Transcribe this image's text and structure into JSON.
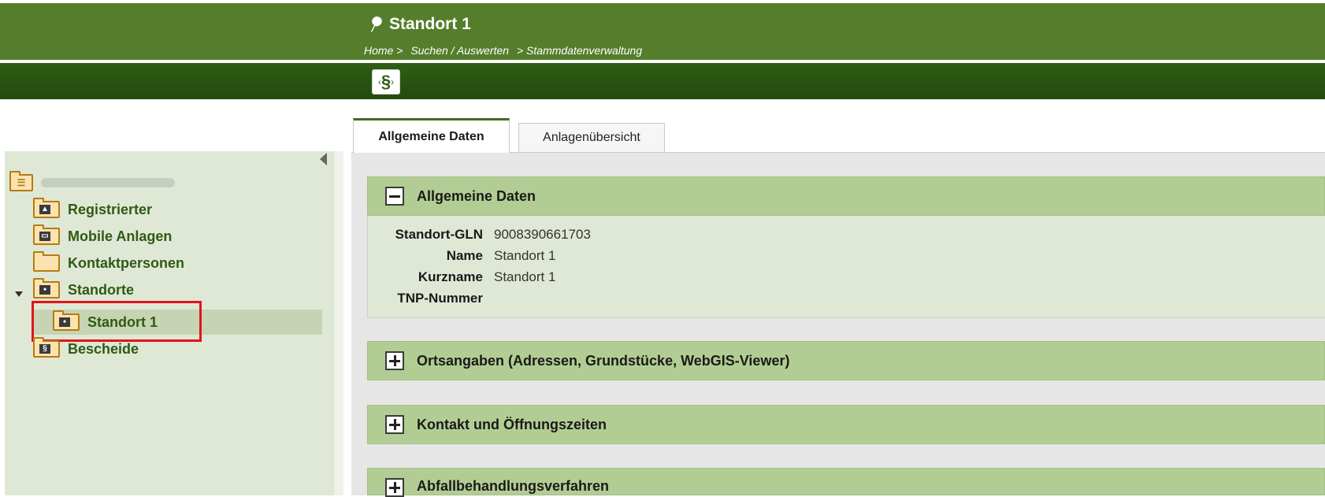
{
  "header": {
    "title": "Standort 1",
    "breadcrumb": [
      "Home >",
      "Suchen / Auswerten",
      "> Stammdatenverwaltung"
    ],
    "paragraph_symbol": "§"
  },
  "tabs": [
    {
      "label": "Allgemeine Daten",
      "active": true
    },
    {
      "label": "Anlagenübersicht",
      "active": false
    }
  ],
  "sidebar": {
    "items": [
      {
        "label": "Registrierter",
        "icon": "person-folder-icon"
      },
      {
        "label": "Mobile Anlagen",
        "icon": "truck-folder-icon"
      },
      {
        "label": "Kontaktpersonen",
        "icon": "folder-icon"
      },
      {
        "label": "Standorte",
        "icon": "pin-folder-icon",
        "expanded": true
      },
      {
        "label": "Standort 1",
        "icon": "pin-folder-icon",
        "selected": true
      },
      {
        "label": "Bescheide",
        "icon": "paragraph-folder-icon"
      }
    ]
  },
  "panels": {
    "allgemeine": {
      "title": "Allgemeine Daten",
      "expanded": true,
      "fields": [
        {
          "label": "Standort-GLN",
          "value": "9008390661703"
        },
        {
          "label": "Name",
          "value": "Standort 1"
        },
        {
          "label": "Kurzname",
          "value": "Standort 1"
        },
        {
          "label": "TNP-Nummer",
          "value": ""
        }
      ]
    },
    "ortsangaben": {
      "title": "Ortsangaben (Adressen, Grundstücke, WebGIS-Viewer)",
      "expanded": false
    },
    "kontakt": {
      "title": "Kontakt und Öffnungszeiten",
      "expanded": false
    },
    "abfall": {
      "title": "Abfallbehandlungsverfahren",
      "expanded": false
    }
  },
  "colors": {
    "header_green": "#547e2c",
    "toolbar_green": "#2f5e14",
    "panel_green": "#b2cd93",
    "sidebar_bg": "#dfe8d5",
    "highlight_red": "#e0141b"
  }
}
